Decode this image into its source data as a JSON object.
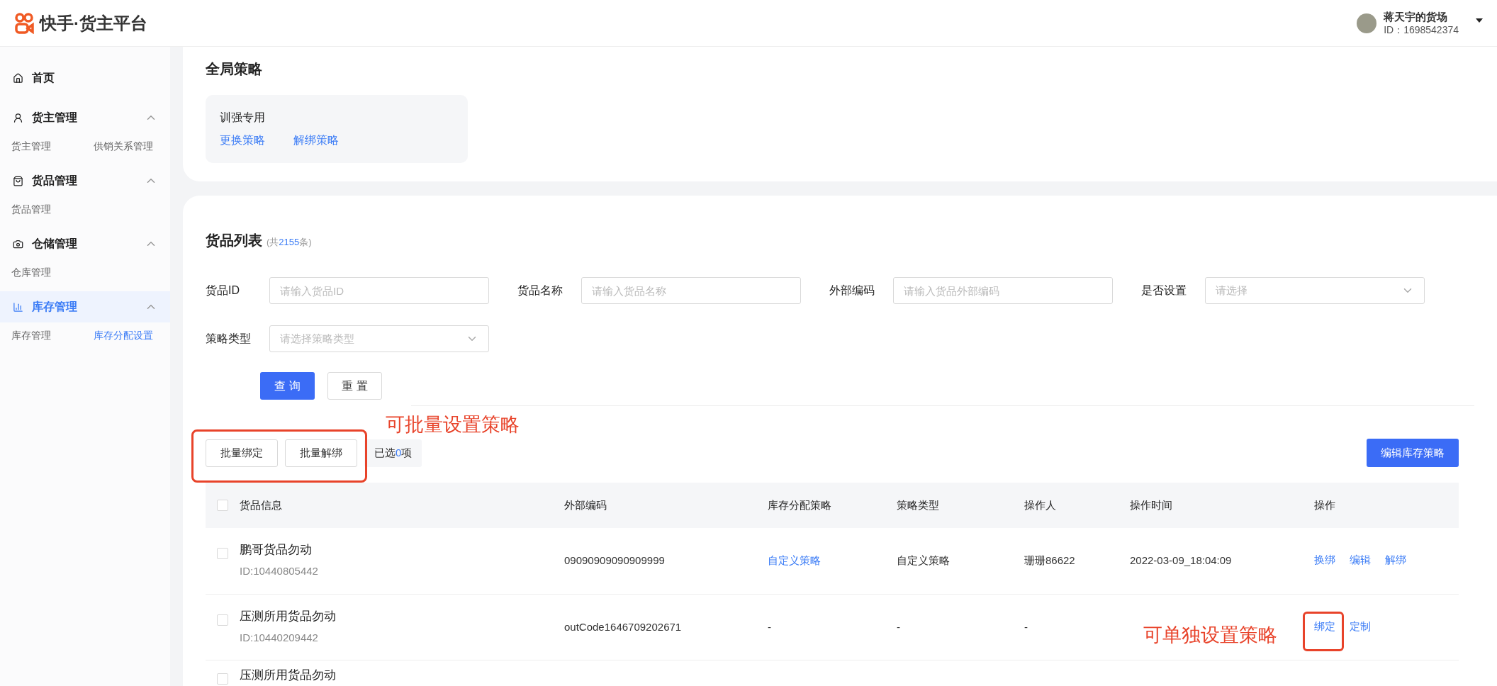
{
  "header": {
    "brand": "快手·货主平台",
    "user": {
      "name": "蒋天宇的货场",
      "id": "ID：1698542374"
    }
  },
  "sidebar": {
    "sections": [
      {
        "kind": "home",
        "label": "首页",
        "selected": false,
        "expanded": false
      },
      {
        "kind": "users",
        "label": "货主管理",
        "selected": false,
        "expanded": true,
        "children": [
          {
            "label": "货主管理",
            "selected": false
          },
          {
            "label": "供销关系管理",
            "selected": false
          }
        ]
      },
      {
        "kind": "bag",
        "label": "货品管理",
        "selected": false,
        "expanded": true,
        "children": [
          {
            "label": "货品管理",
            "selected": false
          }
        ]
      },
      {
        "kind": "warehouse",
        "label": "仓储管理",
        "selected": false,
        "expanded": true,
        "children": [
          {
            "label": "仓库管理",
            "selected": false
          }
        ]
      },
      {
        "kind": "chart",
        "label": "库存管理",
        "selected": true,
        "expanded": true,
        "children": [
          {
            "label": "库存管理",
            "selected": false
          },
          {
            "label": "库存分配设置",
            "selected": true
          }
        ]
      }
    ]
  },
  "global_strategy": {
    "title": "全局策略",
    "name": "训强专用",
    "links": [
      "更换策略",
      "解绑策略"
    ]
  },
  "goods_list": {
    "title": "货品列表",
    "count_prefix": "(共",
    "count": "2155",
    "count_suffix": "条)",
    "filters": [
      {
        "kind": "input",
        "label": "货品ID",
        "placeholder": "请输入货品ID"
      },
      {
        "kind": "input",
        "label": "货品名称",
        "placeholder": "请输入货品名称"
      },
      {
        "kind": "input",
        "label": "外部编码",
        "placeholder": "请输入货品外部编码"
      },
      {
        "kind": "select",
        "label": "是否设置",
        "placeholder": "请选择"
      },
      {
        "kind": "select",
        "label": "策略类型",
        "placeholder": "请选择策略类型"
      }
    ],
    "query_button": "查 询",
    "reset_button": "重 置",
    "batch_buttons": [
      "批量绑定",
      "批量解绑"
    ],
    "selected_prefix": "已选",
    "selected_count": "0",
    "selected_suffix": "项",
    "edit_button": "编辑库存策略",
    "table": {
      "select_all_checked": false,
      "columns": [
        "货品信息",
        "外部编码",
        "库存分配策略",
        "策略类型",
        "操作人",
        "操作时间",
        "操作"
      ],
      "rows": [
        {
          "checked": false,
          "name": "鹏哥货品勿动",
          "id": "ID:10440805442",
          "external_code": "09090909090909999",
          "strategy": {
            "kind": "link",
            "text": "自定义策略"
          },
          "strategy_type": "自定义策略",
          "operator": "珊珊86622",
          "time": "2022-03-09_18:04:09",
          "actions": [
            "换绑",
            "编辑",
            "解绑"
          ]
        },
        {
          "checked": false,
          "name": "压测所用货品勿动",
          "id": "ID:10440209442",
          "external_code": "outCode1646709202671",
          "strategy": {
            "kind": "plain",
            "text": "-"
          },
          "strategy_type": "-",
          "operator": "-",
          "actions": [
            "绑定",
            "定制"
          ]
        },
        {
          "checked": false,
          "name": "压测所用货品勿动"
        }
      ]
    }
  },
  "annotations": [
    {
      "text": "可批量设置策略"
    },
    {
      "text": "可单独设置策略"
    }
  ]
}
